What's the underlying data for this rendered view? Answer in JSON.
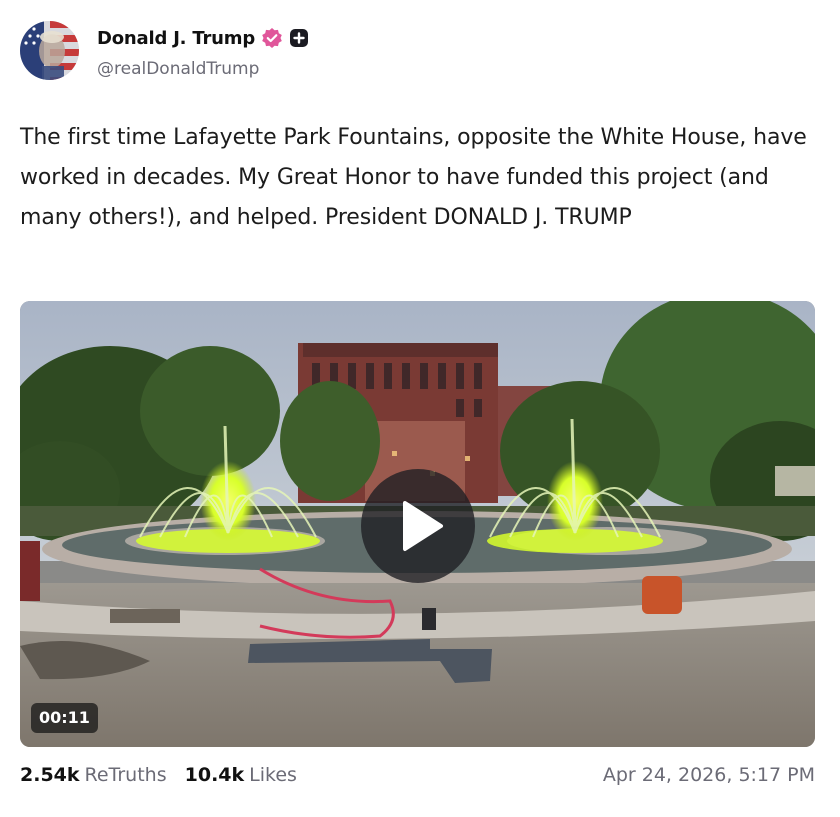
{
  "author": {
    "display_name": "Donald J. Trump",
    "handle": "@realDonaldTrump",
    "avatar_icon": "flag-portrait-avatar",
    "verified_icon": "verified-badge-icon",
    "plus_icon": "plus-badge-icon"
  },
  "post": {
    "text": "The first time Lafayette Park Fountains, opposite the White House, have worked in decades. My Great Honor to have funded this project (and many others!), and helped. President DONALD J. TRUMP"
  },
  "media": {
    "type": "video",
    "duration": "00:11",
    "play_icon": "play-icon"
  },
  "stats": {
    "retruths_count": "2.54k",
    "retruths_label": "ReTruths",
    "likes_count": "10.4k",
    "likes_label": "Likes"
  },
  "timestamp": "Apr 24, 2026, 5:17 PM",
  "colors": {
    "verified_badge": "#e0569a",
    "fountain_glow": "#d8ff2a",
    "muted_text": "#6b6b76"
  }
}
